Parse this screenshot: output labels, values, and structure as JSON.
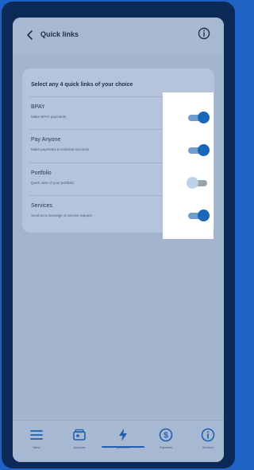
{
  "header": {
    "title": "Quick links",
    "back_icon": "chevron-left-icon",
    "info_icon": "info-icon"
  },
  "card": {
    "heading": "Select any 4 quick links of your choice",
    "items": [
      {
        "title": "BPAY",
        "subtitle": "Make BPAY payments",
        "enabled": true
      },
      {
        "title": "Pay Anyone",
        "subtitle": "Make payments to external accounts",
        "enabled": true
      },
      {
        "title": "Portfolio",
        "subtitle": "Quick view of your portfolio",
        "enabled": false
      },
      {
        "title": "Services",
        "subtitle": "Send us a message or service request",
        "enabled": true
      }
    ]
  },
  "tabs": [
    {
      "label": "Menu",
      "icon": "menu-icon"
    },
    {
      "label": "Accounts",
      "icon": "accounts-icon"
    },
    {
      "label": "Quick links",
      "icon": "lightning-icon",
      "active": true
    },
    {
      "label": "Payments",
      "icon": "dollar-icon"
    },
    {
      "label": "Services",
      "icon": "info-icon"
    }
  ],
  "colors": {
    "accent": "#1a66b8",
    "frame": "#1e63c4",
    "screen": "#a3b5ce"
  }
}
